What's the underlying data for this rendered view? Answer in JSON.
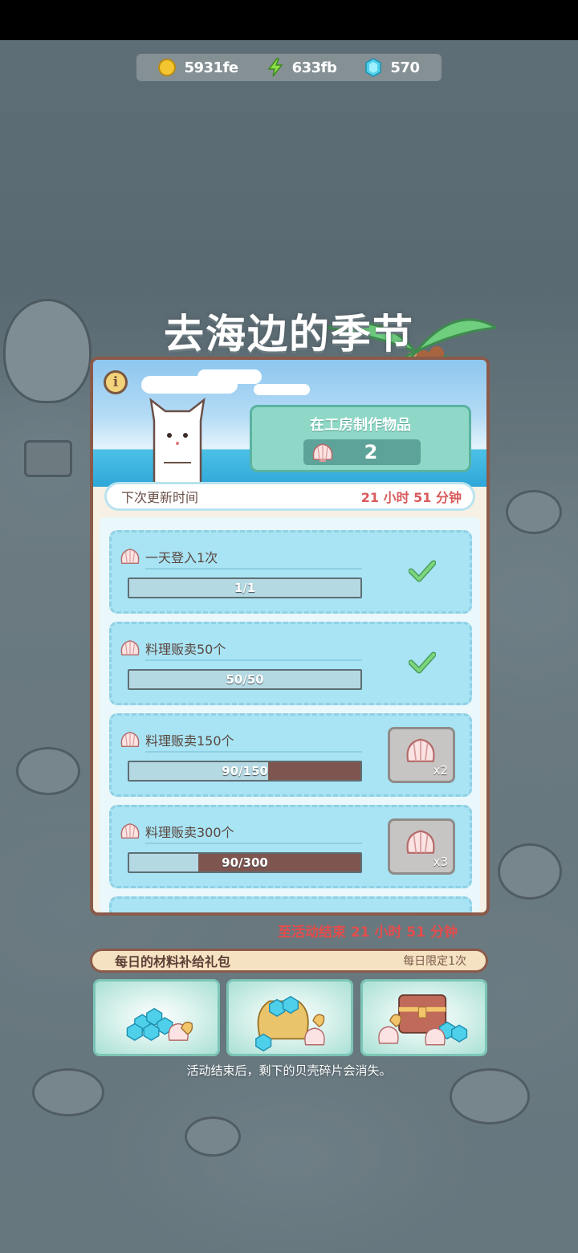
{
  "currency": {
    "gold": "5931fe",
    "energy": "633fb",
    "gems": "570"
  },
  "event": {
    "title": "去海边的季节",
    "craft_title": "在工房制作物品",
    "craft_count": "2",
    "refresh_label": "下次更新时间",
    "refresh_time": "21 小时 51 分钟",
    "end_label": "至活动结束  21 小时 51 分钟"
  },
  "tasks": [
    {
      "label": "一天登入1次",
      "progress_text": "1/1",
      "progress": 1.0,
      "state": "completed"
    },
    {
      "label": "料理贩卖50个",
      "progress_text": "50/50",
      "progress": 1.0,
      "state": "completed"
    },
    {
      "label": "料理贩卖150个",
      "progress_text": "90/150",
      "progress": 0.6,
      "state": "in_progress",
      "reward_qty": "x2"
    },
    {
      "label": "料理贩卖300个",
      "progress_text": "90/300",
      "progress": 0.3,
      "state": "in_progress",
      "reward_qty": "x3"
    }
  ],
  "packs": {
    "title": "每日的材料补给礼包",
    "limit": "每日限定1次",
    "items": [
      {
        "name": "gem-and-shell-pack"
      },
      {
        "name": "gem-bag-pack"
      },
      {
        "name": "treasure-chest-pack"
      }
    ]
  },
  "footnote": "活动结束后，剩下的贝壳碎片会消失。",
  "colors": {
    "panel_border": "#8a5a4a",
    "task_bg": "#a8e4f4",
    "progress_fill": "#7f5550",
    "accent_red": "#e34d4d",
    "craft_green": "#8fd7c6"
  }
}
